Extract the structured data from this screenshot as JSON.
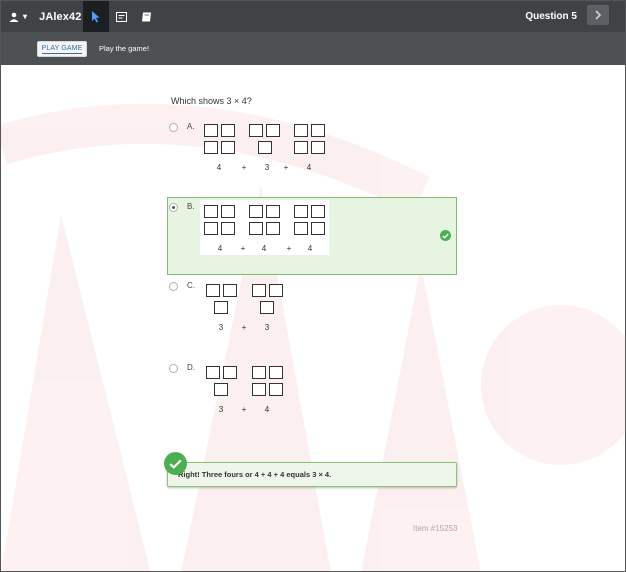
{
  "topbar": {
    "username": "JAlex42",
    "question_label": "Question 5",
    "icons": [
      "user-icon",
      "caret-down-icon",
      "pointer-icon",
      "notepad-icon",
      "book-icon",
      "chevron-right-icon"
    ]
  },
  "subbar": {
    "play_button": "PLAY GAME",
    "play_text": "Play the game!"
  },
  "question": {
    "prompt": "Which shows 3 × 4?"
  },
  "options": [
    {
      "letter": "A.",
      "selected": false,
      "groups": [
        4,
        3,
        4
      ],
      "labels": [
        "4",
        "+",
        "3",
        "+",
        "4"
      ]
    },
    {
      "letter": "B.",
      "selected": true,
      "groups": [
        4,
        4,
        4
      ],
      "labels": [
        "4",
        "+",
        "4",
        "+",
        "4"
      ]
    },
    {
      "letter": "C.",
      "selected": false,
      "groups": [
        3,
        3
      ],
      "labels": [
        "3",
        "+",
        "3"
      ]
    },
    {
      "letter": "D.",
      "selected": false,
      "groups": [
        3,
        4
      ],
      "labels": [
        "3",
        "+",
        "4"
      ]
    }
  ],
  "feedback": {
    "text": "Right! Three fours or 4 + 4 + 4 equals 3 × 4."
  },
  "footer": {
    "item_id": "Item #15253"
  },
  "colors": {
    "topbar": "#3f4346",
    "subbar": "#4d5154",
    "correct_green": "#4caf50",
    "selected_bg": "#e6f4e1"
  }
}
